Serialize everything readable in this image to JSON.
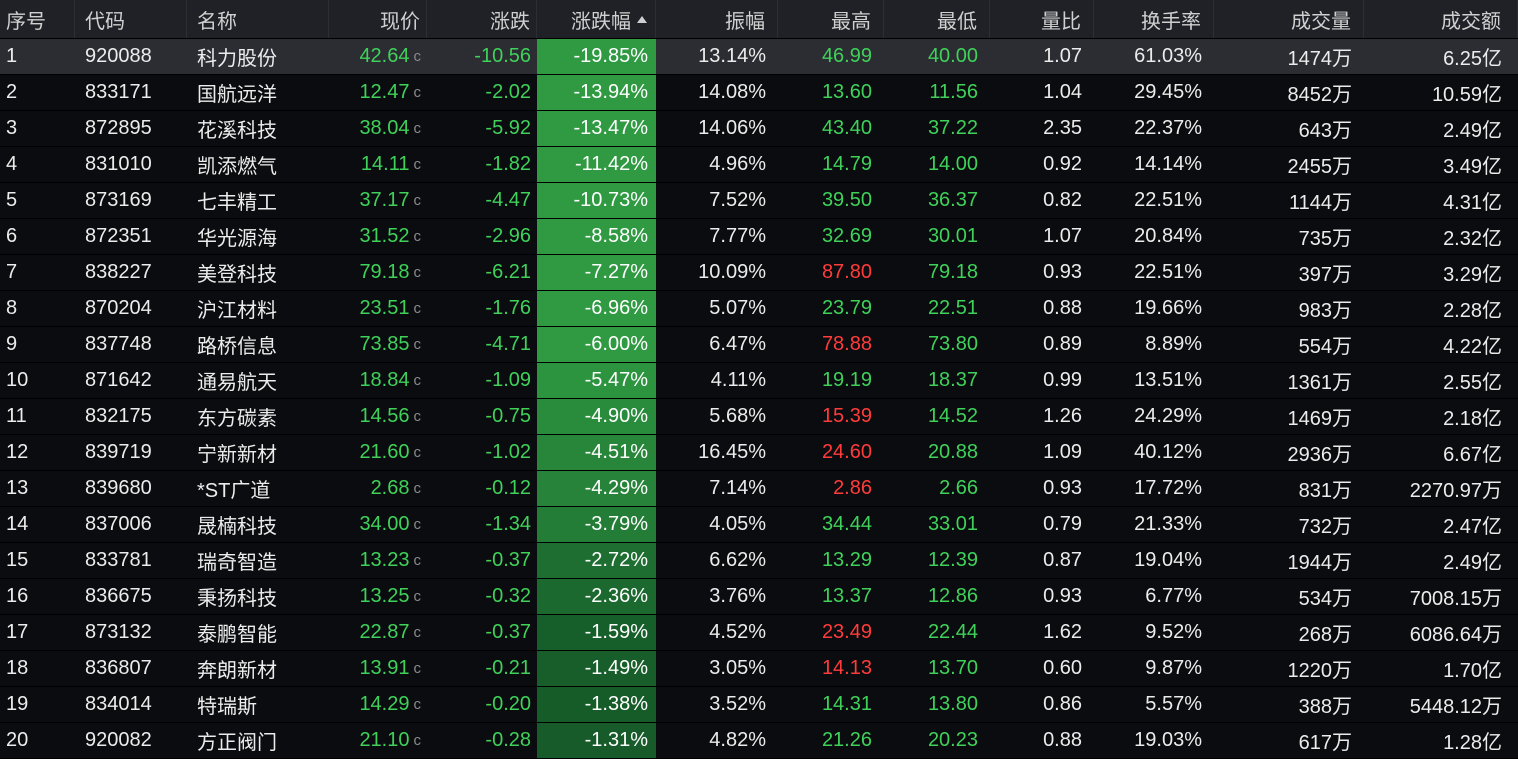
{
  "headers": [
    "序号",
    "代码",
    "名称",
    "现价",
    "涨跌",
    "涨跌幅",
    "振幅",
    "最高",
    "最低",
    "量比",
    "换手率",
    "成交量",
    "成交额"
  ],
  "c_mark": "c",
  "colors": {
    "up": "#ff3b3b",
    "down": "#3fd15a",
    "neutral": "#ececec",
    "chg_strong": "#2f9a42",
    "chg_weak": "#0f4a22"
  },
  "rows": [
    {
      "no": "1",
      "code": "920088",
      "name": "科力股份",
      "price": "42.64",
      "chg": "-10.56",
      "pct": "-19.85%",
      "amp": "13.14%",
      "high": "46.99",
      "low": "40.00",
      "vr": "1.07",
      "turnover": "61.03%",
      "vol": "1474万",
      "amt": "6.25亿",
      "high_up": false,
      "pct_val": 19.85
    },
    {
      "no": "2",
      "code": "833171",
      "name": "国航远洋",
      "price": "12.47",
      "chg": "-2.02",
      "pct": "-13.94%",
      "amp": "14.08%",
      "high": "13.60",
      "low": "11.56",
      "vr": "1.04",
      "turnover": "29.45%",
      "vol": "8452万",
      "amt": "10.59亿",
      "high_up": false,
      "pct_val": 13.94
    },
    {
      "no": "3",
      "code": "872895",
      "name": "花溪科技",
      "price": "38.04",
      "chg": "-5.92",
      "pct": "-13.47%",
      "amp": "14.06%",
      "high": "43.40",
      "low": "37.22",
      "vr": "2.35",
      "turnover": "22.37%",
      "vol": "643万",
      "amt": "2.49亿",
      "high_up": false,
      "pct_val": 13.47
    },
    {
      "no": "4",
      "code": "831010",
      "name": "凯添燃气",
      "price": "14.11",
      "chg": "-1.82",
      "pct": "-11.42%",
      "amp": "4.96%",
      "high": "14.79",
      "low": "14.00",
      "vr": "0.92",
      "turnover": "14.14%",
      "vol": "2455万",
      "amt": "3.49亿",
      "high_up": false,
      "pct_val": 11.42
    },
    {
      "no": "5",
      "code": "873169",
      "name": "七丰精工",
      "price": "37.17",
      "chg": "-4.47",
      "pct": "-10.73%",
      "amp": "7.52%",
      "high": "39.50",
      "low": "36.37",
      "vr": "0.82",
      "turnover": "22.51%",
      "vol": "1144万",
      "amt": "4.31亿",
      "high_up": false,
      "pct_val": 10.73
    },
    {
      "no": "6",
      "code": "872351",
      "name": "华光源海",
      "price": "31.52",
      "chg": "-2.96",
      "pct": "-8.58%",
      "amp": "7.77%",
      "high": "32.69",
      "low": "30.01",
      "vr": "1.07",
      "turnover": "20.84%",
      "vol": "735万",
      "amt": "2.32亿",
      "high_up": false,
      "pct_val": 8.58
    },
    {
      "no": "7",
      "code": "838227",
      "name": "美登科技",
      "price": "79.18",
      "chg": "-6.21",
      "pct": "-7.27%",
      "amp": "10.09%",
      "high": "87.80",
      "low": "79.18",
      "vr": "0.93",
      "turnover": "22.51%",
      "vol": "397万",
      "amt": "3.29亿",
      "high_up": true,
      "pct_val": 7.27
    },
    {
      "no": "8",
      "code": "870204",
      "name": "沪江材料",
      "price": "23.51",
      "chg": "-1.76",
      "pct": "-6.96%",
      "amp": "5.07%",
      "high": "23.79",
      "low": "22.51",
      "vr": "0.88",
      "turnover": "19.66%",
      "vol": "983万",
      "amt": "2.28亿",
      "high_up": false,
      "pct_val": 6.96
    },
    {
      "no": "9",
      "code": "837748",
      "name": "路桥信息",
      "price": "73.85",
      "chg": "-4.71",
      "pct": "-6.00%",
      "amp": "6.47%",
      "high": "78.88",
      "low": "73.80",
      "vr": "0.89",
      "turnover": "8.89%",
      "vol": "554万",
      "amt": "4.22亿",
      "high_up": true,
      "pct_val": 6.0
    },
    {
      "no": "10",
      "code": "871642",
      "name": "通易航天",
      "price": "18.84",
      "chg": "-1.09",
      "pct": "-5.47%",
      "amp": "4.11%",
      "high": "19.19",
      "low": "18.37",
      "vr": "0.99",
      "turnover": "13.51%",
      "vol": "1361万",
      "amt": "2.55亿",
      "high_up": false,
      "pct_val": 5.47
    },
    {
      "no": "11",
      "code": "832175",
      "name": "东方碳素",
      "price": "14.56",
      "chg": "-0.75",
      "pct": "-4.90%",
      "amp": "5.68%",
      "high": "15.39",
      "low": "14.52",
      "vr": "1.26",
      "turnover": "24.29%",
      "vol": "1469万",
      "amt": "2.18亿",
      "high_up": true,
      "pct_val": 4.9
    },
    {
      "no": "12",
      "code": "839719",
      "name": "宁新新材",
      "price": "21.60",
      "chg": "-1.02",
      "pct": "-4.51%",
      "amp": "16.45%",
      "high": "24.60",
      "low": "20.88",
      "vr": "1.09",
      "turnover": "40.12%",
      "vol": "2936万",
      "amt": "6.67亿",
      "high_up": true,
      "pct_val": 4.51
    },
    {
      "no": "13",
      "code": "839680",
      "name": "*ST广道",
      "price": "2.68",
      "chg": "-0.12",
      "pct": "-4.29%",
      "amp": "7.14%",
      "high": "2.86",
      "low": "2.66",
      "vr": "0.93",
      "turnover": "17.72%",
      "vol": "831万",
      "amt": "2270.97万",
      "high_up": true,
      "pct_val": 4.29
    },
    {
      "no": "14",
      "code": "837006",
      "name": "晟楠科技",
      "price": "34.00",
      "chg": "-1.34",
      "pct": "-3.79%",
      "amp": "4.05%",
      "high": "34.44",
      "low": "33.01",
      "vr": "0.79",
      "turnover": "21.33%",
      "vol": "732万",
      "amt": "2.47亿",
      "high_up": false,
      "pct_val": 3.79
    },
    {
      "no": "15",
      "code": "833781",
      "name": "瑞奇智造",
      "price": "13.23",
      "chg": "-0.37",
      "pct": "-2.72%",
      "amp": "6.62%",
      "high": "13.29",
      "low": "12.39",
      "vr": "0.87",
      "turnover": "19.04%",
      "vol": "1944万",
      "amt": "2.49亿",
      "high_up": false,
      "pct_val": 2.72
    },
    {
      "no": "16",
      "code": "836675",
      "name": "秉扬科技",
      "price": "13.25",
      "chg": "-0.32",
      "pct": "-2.36%",
      "amp": "3.76%",
      "high": "13.37",
      "low": "12.86",
      "vr": "0.93",
      "turnover": "6.77%",
      "vol": "534万",
      "amt": "7008.15万",
      "high_up": false,
      "pct_val": 2.36
    },
    {
      "no": "17",
      "code": "873132",
      "name": "泰鹏智能",
      "price": "22.87",
      "chg": "-0.37",
      "pct": "-1.59%",
      "amp": "4.52%",
      "high": "23.49",
      "low": "22.44",
      "vr": "1.62",
      "turnover": "9.52%",
      "vol": "268万",
      "amt": "6086.64万",
      "high_up": true,
      "pct_val": 1.59
    },
    {
      "no": "18",
      "code": "836807",
      "name": "奔朗新材",
      "price": "13.91",
      "chg": "-0.21",
      "pct": "-1.49%",
      "amp": "3.05%",
      "high": "14.13",
      "low": "13.70",
      "vr": "0.60",
      "turnover": "9.87%",
      "vol": "1220万",
      "amt": "1.70亿",
      "high_up": true,
      "pct_val": 1.49
    },
    {
      "no": "19",
      "code": "834014",
      "name": "特瑞斯",
      "price": "14.29",
      "chg": "-0.20",
      "pct": "-1.38%",
      "amp": "3.52%",
      "high": "14.31",
      "low": "13.80",
      "vr": "0.86",
      "turnover": "5.57%",
      "vol": "388万",
      "amt": "5448.12万",
      "high_up": false,
      "pct_val": 1.38
    },
    {
      "no": "20",
      "code": "920082",
      "name": "方正阀门",
      "price": "21.10",
      "chg": "-0.28",
      "pct": "-1.31%",
      "amp": "4.82%",
      "high": "21.26",
      "low": "20.23",
      "vr": "0.88",
      "turnover": "19.03%",
      "vol": "617万",
      "amt": "1.28亿",
      "high_up": false,
      "pct_val": 1.31
    }
  ]
}
